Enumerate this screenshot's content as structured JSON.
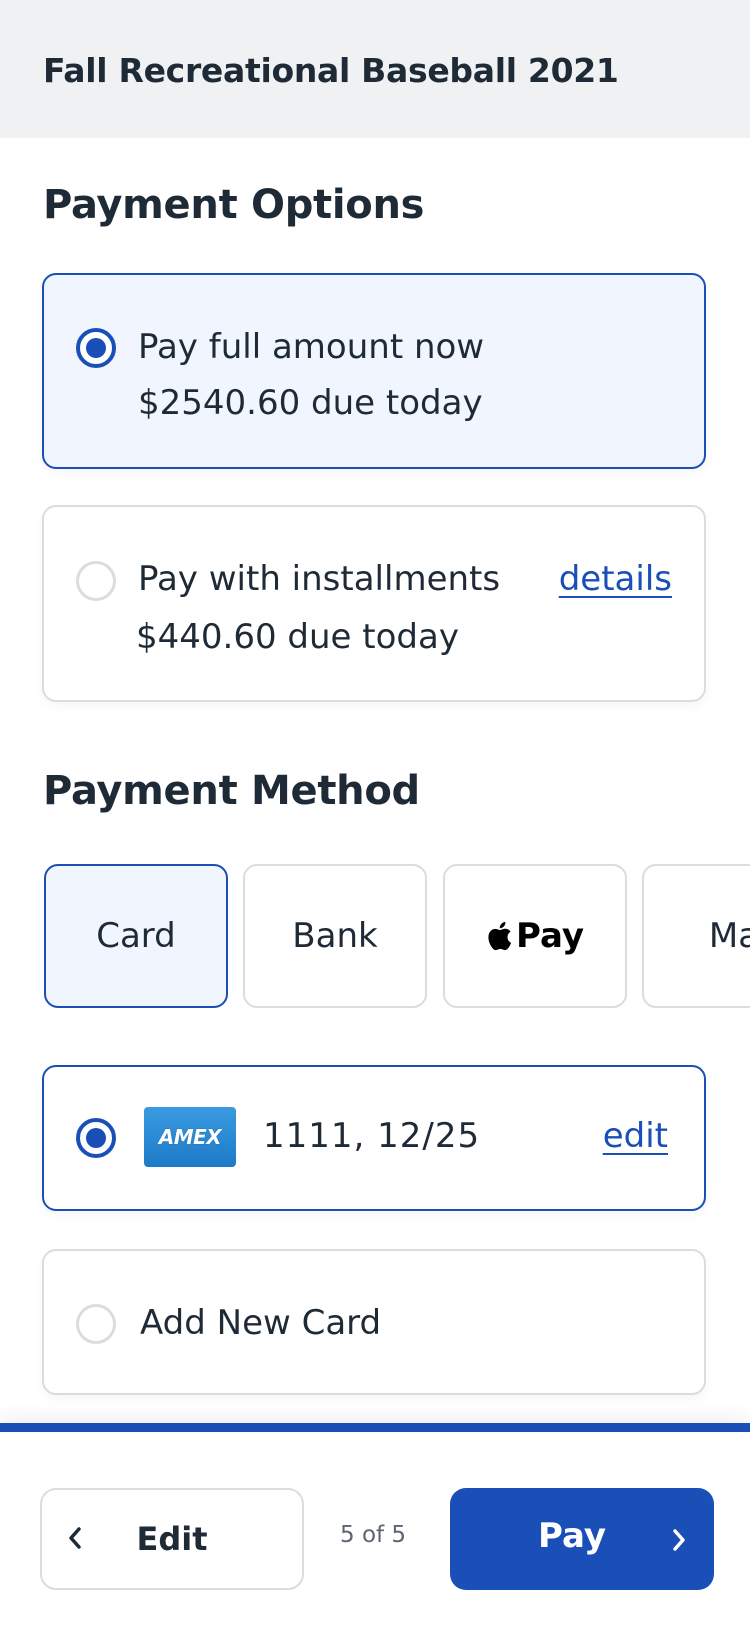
{
  "header": {
    "title": "Fall Recreational Baseball 2021"
  },
  "payment_options": {
    "title": "Payment Options",
    "options": [
      {
        "label": "Pay full amount now",
        "amount": "$2540.60 due today",
        "selected": true
      },
      {
        "label": "Pay with installments",
        "amount": "$440.60 due today",
        "selected": false,
        "link": "details"
      }
    ]
  },
  "payment_method": {
    "title": "Payment Method",
    "tabs": [
      {
        "label": "Card",
        "selected": true
      },
      {
        "label": "Bank",
        "selected": false
      },
      {
        "label": "Pay",
        "icon": "apple-icon",
        "selected": false
      },
      {
        "label": "Ma",
        "selected": false
      }
    ],
    "cards": [
      {
        "brand": "AMEX",
        "details": "1111,  12/25",
        "action": "edit",
        "selected": true,
        "icon": "amex-logo"
      },
      {
        "label": "Add New Card",
        "selected": false
      }
    ]
  },
  "footer": {
    "edit_label": "Edit",
    "step": "5 of 5",
    "pay_label": "Pay"
  },
  "colors": {
    "accent": "#1a4fb8",
    "selected_bg": "#f1f6fe",
    "border": "#d9dde2",
    "header_bg": "#eff1f3"
  }
}
